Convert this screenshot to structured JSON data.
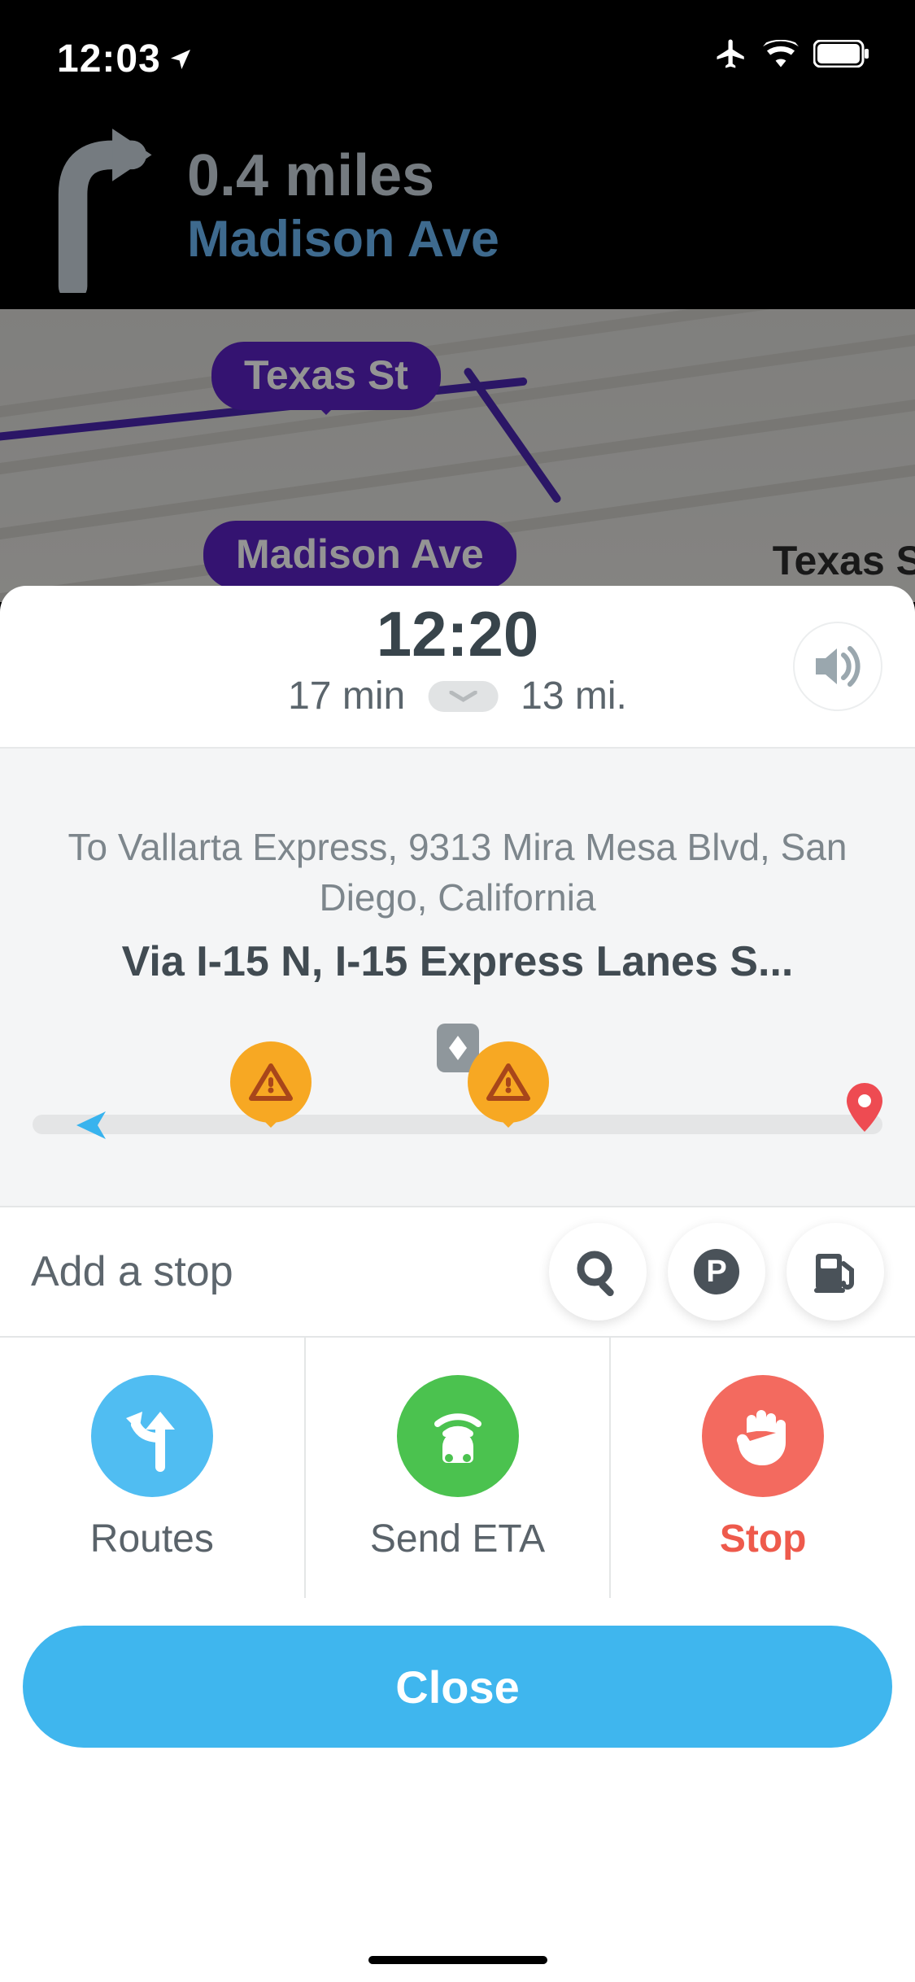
{
  "status": {
    "time": "12:03"
  },
  "nav": {
    "distance": "0.4 miles",
    "street": "Madison Ave"
  },
  "map": {
    "label_texas": "Texas St",
    "label_madison": "Madison Ave",
    "side_label": "Texas S"
  },
  "eta": {
    "arrival": "12:20",
    "duration": "17 min",
    "distance": "13 mi."
  },
  "destination": {
    "to_line": "To Vallarta Express, 9313 Mira Mesa Blvd, San Diego, California",
    "via": "Via I-15 N, I-15 Express Lanes S..."
  },
  "addstop": {
    "label": "Add a stop"
  },
  "actions": {
    "routes": "Routes",
    "send_eta": "Send ETA",
    "stop": "Stop"
  },
  "close": {
    "label": "Close"
  }
}
